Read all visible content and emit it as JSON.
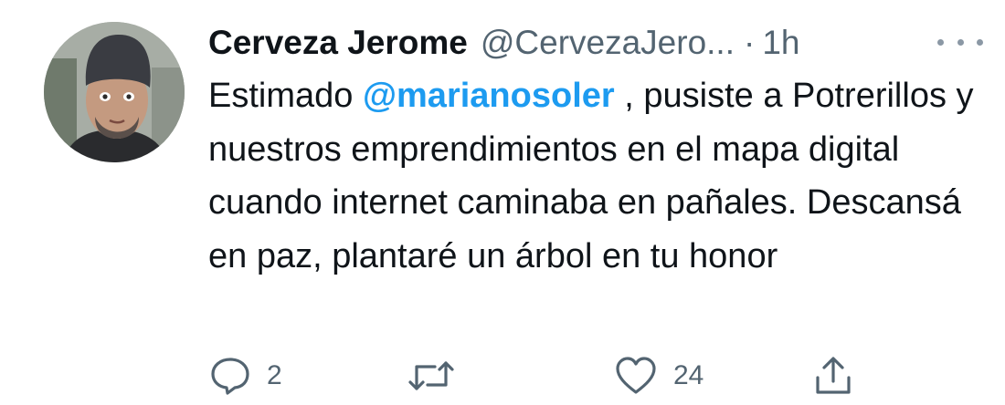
{
  "tweet": {
    "author": {
      "display_name": "Cerveza Jerome",
      "handle": "@CervezaJero...",
      "avatar_icon": "profile-photo"
    },
    "separator": "·",
    "time": "1h",
    "more_icon": "more-options-icon",
    "text_before_mention": "Estimado ",
    "mention": "@marianosoler",
    "text_after_mention": " , pusiste a Potrerillos y nuestros emprendimientos en el mapa digital cuando internet caminaba en pañales. Descansá en paz, plantaré un árbol en tu honor",
    "actions": {
      "reply": {
        "icon": "reply-icon",
        "count": "2"
      },
      "retweet": {
        "icon": "retweet-icon",
        "count": ""
      },
      "like": {
        "icon": "like-icon",
        "count": "24"
      },
      "share": {
        "icon": "share-icon"
      }
    }
  },
  "colors": {
    "text_primary": "#0f1419",
    "text_secondary": "#536471",
    "link": "#1d9bf0",
    "icon": "#536471",
    "background": "#ffffff"
  }
}
